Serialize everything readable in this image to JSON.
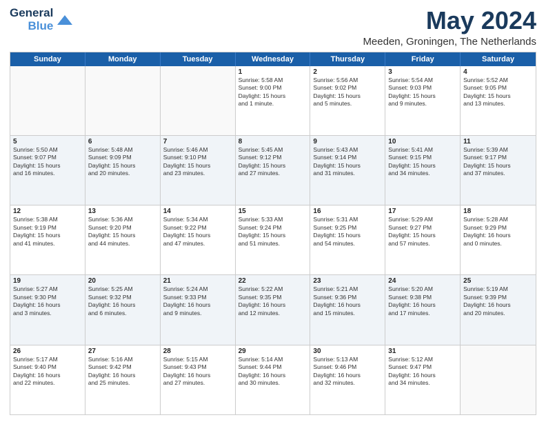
{
  "logo": {
    "line1": "General",
    "line2": "Blue"
  },
  "title": "May 2024",
  "subtitle": "Meeden, Groningen, The Netherlands",
  "days_of_week": [
    "Sunday",
    "Monday",
    "Tuesday",
    "Wednesday",
    "Thursday",
    "Friday",
    "Saturday"
  ],
  "weeks": [
    {
      "shaded": false,
      "cells": [
        {
          "day": "",
          "empty": true,
          "lines": []
        },
        {
          "day": "",
          "empty": true,
          "lines": []
        },
        {
          "day": "",
          "empty": true,
          "lines": []
        },
        {
          "day": "1",
          "empty": false,
          "lines": [
            "Sunrise: 5:58 AM",
            "Sunset: 9:00 PM",
            "Daylight: 15 hours",
            "and 1 minute."
          ]
        },
        {
          "day": "2",
          "empty": false,
          "lines": [
            "Sunrise: 5:56 AM",
            "Sunset: 9:02 PM",
            "Daylight: 15 hours",
            "and 5 minutes."
          ]
        },
        {
          "day": "3",
          "empty": false,
          "lines": [
            "Sunrise: 5:54 AM",
            "Sunset: 9:03 PM",
            "Daylight: 15 hours",
            "and 9 minutes."
          ]
        },
        {
          "day": "4",
          "empty": false,
          "lines": [
            "Sunrise: 5:52 AM",
            "Sunset: 9:05 PM",
            "Daylight: 15 hours",
            "and 13 minutes."
          ]
        }
      ]
    },
    {
      "shaded": true,
      "cells": [
        {
          "day": "5",
          "empty": false,
          "lines": [
            "Sunrise: 5:50 AM",
            "Sunset: 9:07 PM",
            "Daylight: 15 hours",
            "and 16 minutes."
          ]
        },
        {
          "day": "6",
          "empty": false,
          "lines": [
            "Sunrise: 5:48 AM",
            "Sunset: 9:09 PM",
            "Daylight: 15 hours",
            "and 20 minutes."
          ]
        },
        {
          "day": "7",
          "empty": false,
          "lines": [
            "Sunrise: 5:46 AM",
            "Sunset: 9:10 PM",
            "Daylight: 15 hours",
            "and 23 minutes."
          ]
        },
        {
          "day": "8",
          "empty": false,
          "lines": [
            "Sunrise: 5:45 AM",
            "Sunset: 9:12 PM",
            "Daylight: 15 hours",
            "and 27 minutes."
          ]
        },
        {
          "day": "9",
          "empty": false,
          "lines": [
            "Sunrise: 5:43 AM",
            "Sunset: 9:14 PM",
            "Daylight: 15 hours",
            "and 31 minutes."
          ]
        },
        {
          "day": "10",
          "empty": false,
          "lines": [
            "Sunrise: 5:41 AM",
            "Sunset: 9:15 PM",
            "Daylight: 15 hours",
            "and 34 minutes."
          ]
        },
        {
          "day": "11",
          "empty": false,
          "lines": [
            "Sunrise: 5:39 AM",
            "Sunset: 9:17 PM",
            "Daylight: 15 hours",
            "and 37 minutes."
          ]
        }
      ]
    },
    {
      "shaded": false,
      "cells": [
        {
          "day": "12",
          "empty": false,
          "lines": [
            "Sunrise: 5:38 AM",
            "Sunset: 9:19 PM",
            "Daylight: 15 hours",
            "and 41 minutes."
          ]
        },
        {
          "day": "13",
          "empty": false,
          "lines": [
            "Sunrise: 5:36 AM",
            "Sunset: 9:20 PM",
            "Daylight: 15 hours",
            "and 44 minutes."
          ]
        },
        {
          "day": "14",
          "empty": false,
          "lines": [
            "Sunrise: 5:34 AM",
            "Sunset: 9:22 PM",
            "Daylight: 15 hours",
            "and 47 minutes."
          ]
        },
        {
          "day": "15",
          "empty": false,
          "lines": [
            "Sunrise: 5:33 AM",
            "Sunset: 9:24 PM",
            "Daylight: 15 hours",
            "and 51 minutes."
          ]
        },
        {
          "day": "16",
          "empty": false,
          "lines": [
            "Sunrise: 5:31 AM",
            "Sunset: 9:25 PM",
            "Daylight: 15 hours",
            "and 54 minutes."
          ]
        },
        {
          "day": "17",
          "empty": false,
          "lines": [
            "Sunrise: 5:29 AM",
            "Sunset: 9:27 PM",
            "Daylight: 15 hours",
            "and 57 minutes."
          ]
        },
        {
          "day": "18",
          "empty": false,
          "lines": [
            "Sunrise: 5:28 AM",
            "Sunset: 9:29 PM",
            "Daylight: 16 hours",
            "and 0 minutes."
          ]
        }
      ]
    },
    {
      "shaded": true,
      "cells": [
        {
          "day": "19",
          "empty": false,
          "lines": [
            "Sunrise: 5:27 AM",
            "Sunset: 9:30 PM",
            "Daylight: 16 hours",
            "and 3 minutes."
          ]
        },
        {
          "day": "20",
          "empty": false,
          "lines": [
            "Sunrise: 5:25 AM",
            "Sunset: 9:32 PM",
            "Daylight: 16 hours",
            "and 6 minutes."
          ]
        },
        {
          "day": "21",
          "empty": false,
          "lines": [
            "Sunrise: 5:24 AM",
            "Sunset: 9:33 PM",
            "Daylight: 16 hours",
            "and 9 minutes."
          ]
        },
        {
          "day": "22",
          "empty": false,
          "lines": [
            "Sunrise: 5:22 AM",
            "Sunset: 9:35 PM",
            "Daylight: 16 hours",
            "and 12 minutes."
          ]
        },
        {
          "day": "23",
          "empty": false,
          "lines": [
            "Sunrise: 5:21 AM",
            "Sunset: 9:36 PM",
            "Daylight: 16 hours",
            "and 15 minutes."
          ]
        },
        {
          "day": "24",
          "empty": false,
          "lines": [
            "Sunrise: 5:20 AM",
            "Sunset: 9:38 PM",
            "Daylight: 16 hours",
            "and 17 minutes."
          ]
        },
        {
          "day": "25",
          "empty": false,
          "lines": [
            "Sunrise: 5:19 AM",
            "Sunset: 9:39 PM",
            "Daylight: 16 hours",
            "and 20 minutes."
          ]
        }
      ]
    },
    {
      "shaded": false,
      "cells": [
        {
          "day": "26",
          "empty": false,
          "lines": [
            "Sunrise: 5:17 AM",
            "Sunset: 9:40 PM",
            "Daylight: 16 hours",
            "and 22 minutes."
          ]
        },
        {
          "day": "27",
          "empty": false,
          "lines": [
            "Sunrise: 5:16 AM",
            "Sunset: 9:42 PM",
            "Daylight: 16 hours",
            "and 25 minutes."
          ]
        },
        {
          "day": "28",
          "empty": false,
          "lines": [
            "Sunrise: 5:15 AM",
            "Sunset: 9:43 PM",
            "Daylight: 16 hours",
            "and 27 minutes."
          ]
        },
        {
          "day": "29",
          "empty": false,
          "lines": [
            "Sunrise: 5:14 AM",
            "Sunset: 9:44 PM",
            "Daylight: 16 hours",
            "and 30 minutes."
          ]
        },
        {
          "day": "30",
          "empty": false,
          "lines": [
            "Sunrise: 5:13 AM",
            "Sunset: 9:46 PM",
            "Daylight: 16 hours",
            "and 32 minutes."
          ]
        },
        {
          "day": "31",
          "empty": false,
          "lines": [
            "Sunrise: 5:12 AM",
            "Sunset: 9:47 PM",
            "Daylight: 16 hours",
            "and 34 minutes."
          ]
        },
        {
          "day": "",
          "empty": true,
          "lines": []
        }
      ]
    }
  ]
}
